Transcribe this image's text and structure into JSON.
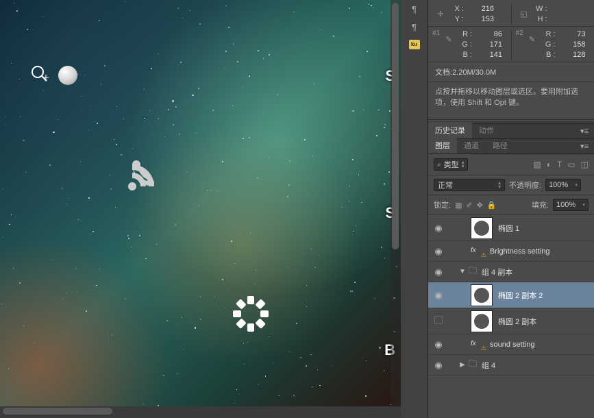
{
  "info_panel": {
    "position": {
      "x_label": "X :",
      "y_label": "Y :",
      "x": "216",
      "y": "153"
    },
    "dimensions": {
      "w_label": "W :",
      "h_label": "H :",
      "w": "",
      "h": ""
    },
    "sample1": {
      "num": "#1",
      "r_label": "R :",
      "g_label": "G :",
      "b_label": "B :",
      "r": "86",
      "g": "171",
      "b": "141"
    },
    "sample2": {
      "num": "#2",
      "r_label": "R :",
      "g_label": "G :",
      "b_label": "B :",
      "r": "73",
      "g": "158",
      "b": "128"
    },
    "doc_label": "文档:",
    "doc_value": "2.20M/30.0M",
    "hint": "点按并拖移以移动图层或选区。要用附加选项，使用 Shift 和 Opt 键。"
  },
  "tabs_history": {
    "history": "历史记录",
    "actions": "动作"
  },
  "tabs_layers": {
    "layers": "图层",
    "channels": "通道",
    "paths": "路径"
  },
  "layer_options": {
    "filter_kind": "类型",
    "blend_mode": "正常",
    "opacity_label": "不透明度:",
    "opacity": "100%",
    "lock_label": "锁定:",
    "fill_label": "填充:",
    "fill": "100%"
  },
  "layers": [
    {
      "name": "椭圆 1"
    },
    {
      "name": "Brightness setting"
    },
    {
      "name": "组 4 副本"
    },
    {
      "name": "椭圆 2 副本 2"
    },
    {
      "name": "椭圆 2 副本"
    },
    {
      "name": "sound setting"
    },
    {
      "name": "组 4"
    }
  ],
  "canvas_letters": {
    "s": "S",
    "b": "B"
  }
}
